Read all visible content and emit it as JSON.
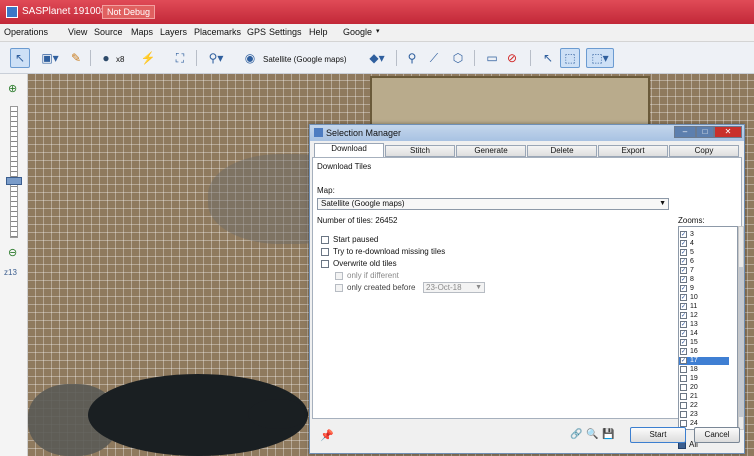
{
  "window": {
    "title": "SASPlanet 191008",
    "badge": "Not Debug"
  },
  "menu": {
    "items": [
      "Operations",
      "View",
      "Source",
      "Maps",
      "Layers",
      "Placemarks",
      "GPS",
      "Settings",
      "Help",
      "Google"
    ]
  },
  "toolbar": {
    "zoom_label": "x8",
    "map_label": "Satellite (Google maps)"
  },
  "leftpanel": {
    "zoom_level": "z13"
  },
  "dialog": {
    "title": "Selection Manager",
    "tabs": [
      "Download",
      "Stitch",
      "Generate",
      "Delete",
      "Export",
      "Copy"
    ],
    "active_tab": "Download",
    "panel_header": "Download Tiles",
    "map_label": "Map:",
    "map_value": "Satellite (Google maps)",
    "tiles_count": "Number of tiles: 26452",
    "options": {
      "start_paused": "Start paused",
      "redownload_missing": "Try to re-download missing tiles",
      "overwrite_old": "Overwrite old tiles",
      "only_if_different": "only if different",
      "only_created_before": "only created before",
      "date_value": "23-Oct-18"
    },
    "zooms_label": "Zooms:",
    "zooms": [
      "3",
      "4",
      "5",
      "6",
      "7",
      "8",
      "9",
      "10",
      "11",
      "12",
      "13",
      "14",
      "15",
      "16",
      "17",
      "18",
      "19",
      "20",
      "21",
      "22",
      "23",
      "24"
    ],
    "zooms_checked": [
      "3",
      "4",
      "5",
      "6",
      "7",
      "8",
      "9",
      "10",
      "11",
      "12",
      "13",
      "14",
      "15",
      "16",
      "17"
    ],
    "zooms_selected": "17",
    "all_label": "All",
    "start_button": "Start",
    "cancel_button": "Cancel"
  },
  "colors": {
    "titlebar": "#c22838",
    "accent": "#3f7fd3"
  }
}
